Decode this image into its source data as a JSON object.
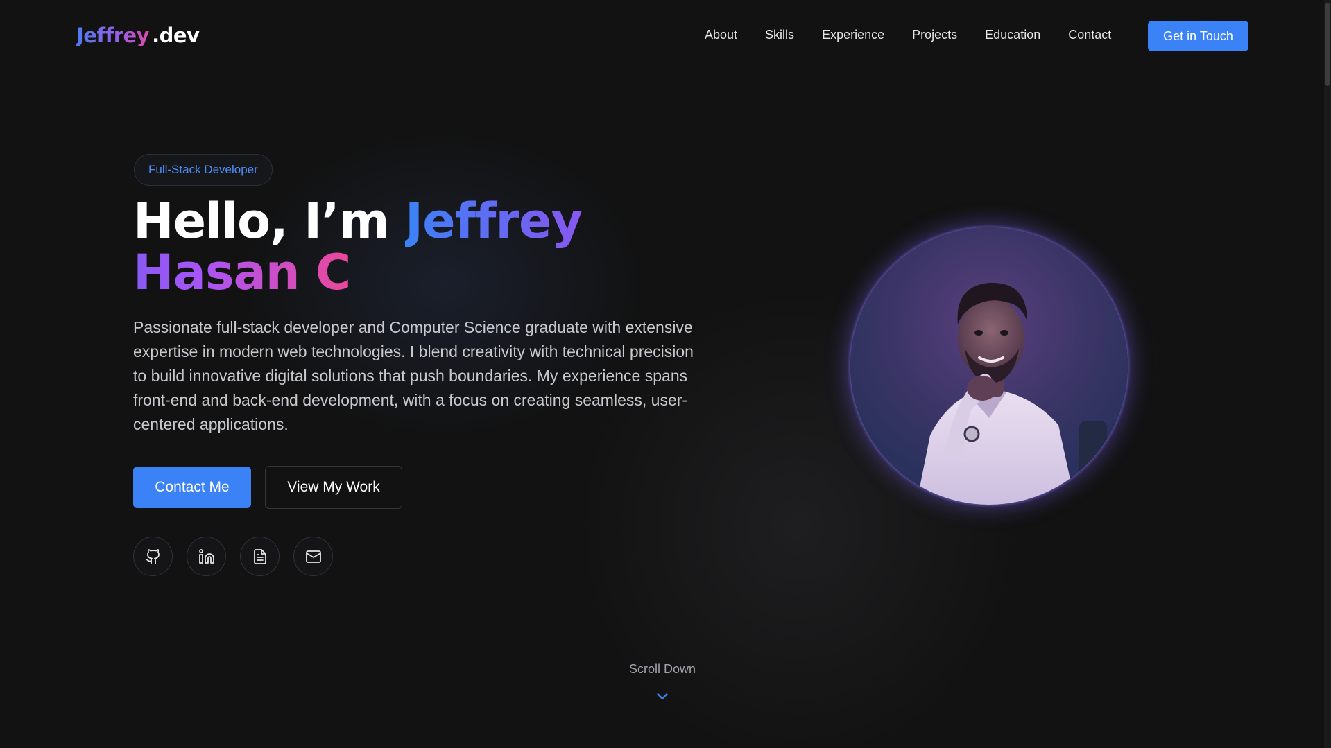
{
  "brand": {
    "logo_main": "Jeffrey",
    "logo_suffix": ".dev"
  },
  "nav": {
    "items": [
      "About",
      "Skills",
      "Experience",
      "Projects",
      "Education",
      "Contact"
    ],
    "cta_label": "Get in Touch"
  },
  "hero": {
    "badge": "Full-Stack Developer",
    "greeting": "Hello, I’m ",
    "name": "Jeffrey Hasan C",
    "description": "Passionate full-stack developer and Computer Science graduate with extensive expertise in modern web technologies. I blend creativity with technical precision to build innovative digital solutions that push boundaries. My experience spans front-end and back-end development, with a focus on creating seamless, user-centered applications.",
    "primary_button": "Contact Me",
    "secondary_button": "View My Work",
    "socials": [
      {
        "icon": "github-icon"
      },
      {
        "icon": "linkedin-icon"
      },
      {
        "icon": "resume-document-icon"
      },
      {
        "icon": "mail-icon"
      }
    ],
    "avatar_icon": "profile-photo"
  },
  "scroll": {
    "label": "Scroll Down",
    "icon": "chevron-down-icon"
  },
  "colors": {
    "accent": "#3b82f6",
    "gradient_start": "#3b82f6",
    "gradient_mid": "#a855f7",
    "gradient_end": "#ec4899",
    "background": "#121212"
  }
}
